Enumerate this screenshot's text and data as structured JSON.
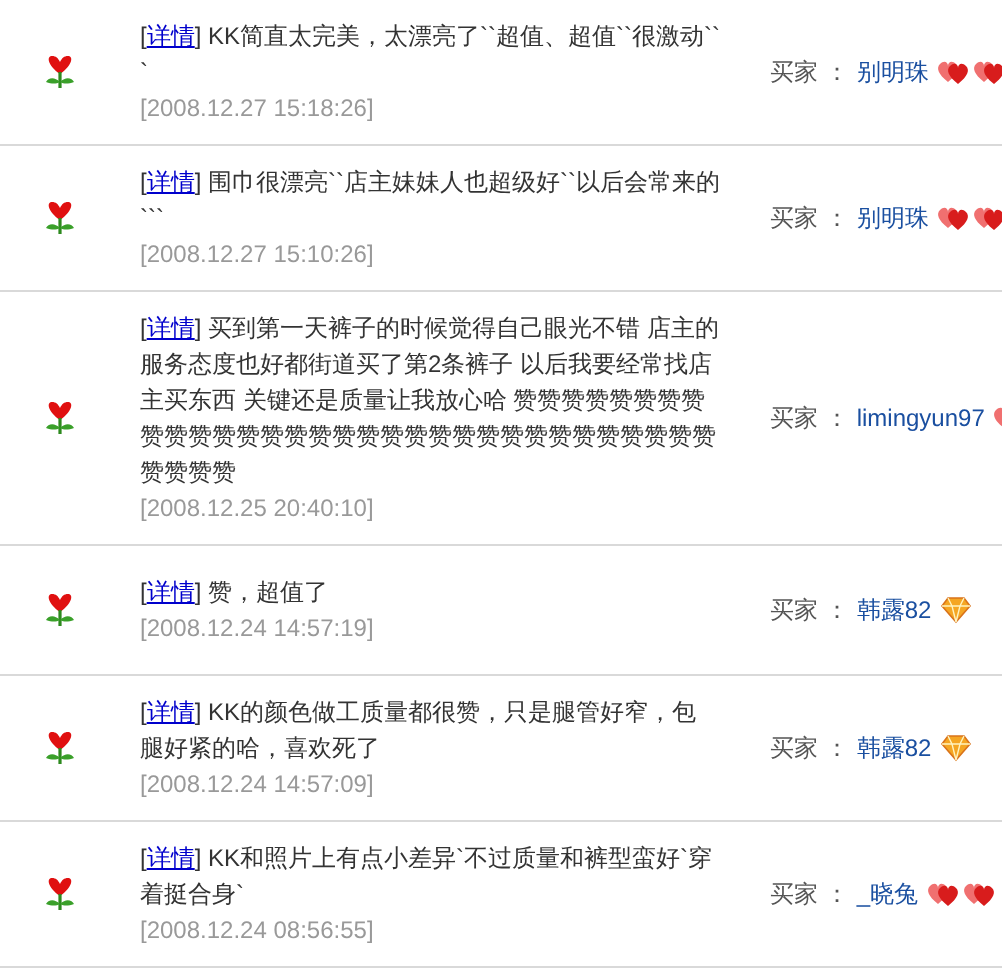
{
  "reviews": [
    {
      "bracket_open": "[",
      "detail_link": "详情",
      "bracket_close": "]",
      "comment": "KK简直太完美，太漂亮了``超值、超值``很激动```",
      "date": "[2008.12.27 15:18:26]",
      "buyer_label": "买家 ：",
      "buyer": "别明珠",
      "rank_icons": [
        {
          "kind": "heart"
        },
        {
          "kind": "heart"
        }
      ]
    },
    {
      "bracket_open": "[",
      "detail_link": "详情",
      "bracket_close": "]",
      "comment": "围巾很漂亮``店主妹妹人也超级好``以后会常来的```",
      "date": "[2008.12.27 15:10:26]",
      "buyer_label": "买家 ：",
      "buyer": "别明珠",
      "rank_icons": [
        {
          "kind": "heart"
        },
        {
          "kind": "heart"
        }
      ]
    },
    {
      "bracket_open": "[",
      "detail_link": "详情",
      "bracket_close": "]",
      "comment": "买到第一天裤子的时候觉得自己眼光不错 店主的服务态度也好都街道买了第2条裤子 以后我要经常找店主买东西 关键还是质量让我放心哈 赞赞赞赞赞赞赞赞赞赞赞赞赞赞赞赞赞赞赞赞赞赞赞赞赞赞赞赞赞赞赞赞赞赞赞赞",
      "date": "[2008.12.25 20:40:10]",
      "buyer_label": "买家 ：",
      "buyer": "limingyun97",
      "rank_icons": [
        {
          "kind": "heart"
        }
      ]
    },
    {
      "bracket_open": "[",
      "detail_link": "详情",
      "bracket_close": "]",
      "comment": "赞，超值了",
      "date": "[2008.12.24 14:57:19]",
      "buyer_label": "买家 ：",
      "buyer": "韩露82",
      "rank_icons": [
        {
          "kind": "diamond"
        }
      ]
    },
    {
      "bracket_open": "[",
      "detail_link": "详情",
      "bracket_close": "]",
      "comment": "KK的颜色做工质量都很赞，只是腿管好窄，包腿好紧的哈，喜欢死了",
      "date": "[2008.12.24 14:57:09]",
      "buyer_label": "买家 ：",
      "buyer": "韩露82",
      "rank_icons": [
        {
          "kind": "diamond"
        }
      ]
    },
    {
      "bracket_open": "[",
      "detail_link": "详情",
      "bracket_close": "]",
      "comment": "KK和照片上有点小差异`不过质量和裤型蛮好`穿着挺合身`",
      "date": "[2008.12.24 08:56:55]",
      "buyer_label": "买家 ：",
      "buyer": "_晓兔",
      "rank_icons": [
        {
          "kind": "heart"
        },
        {
          "kind": "heart"
        }
      ]
    }
  ]
}
